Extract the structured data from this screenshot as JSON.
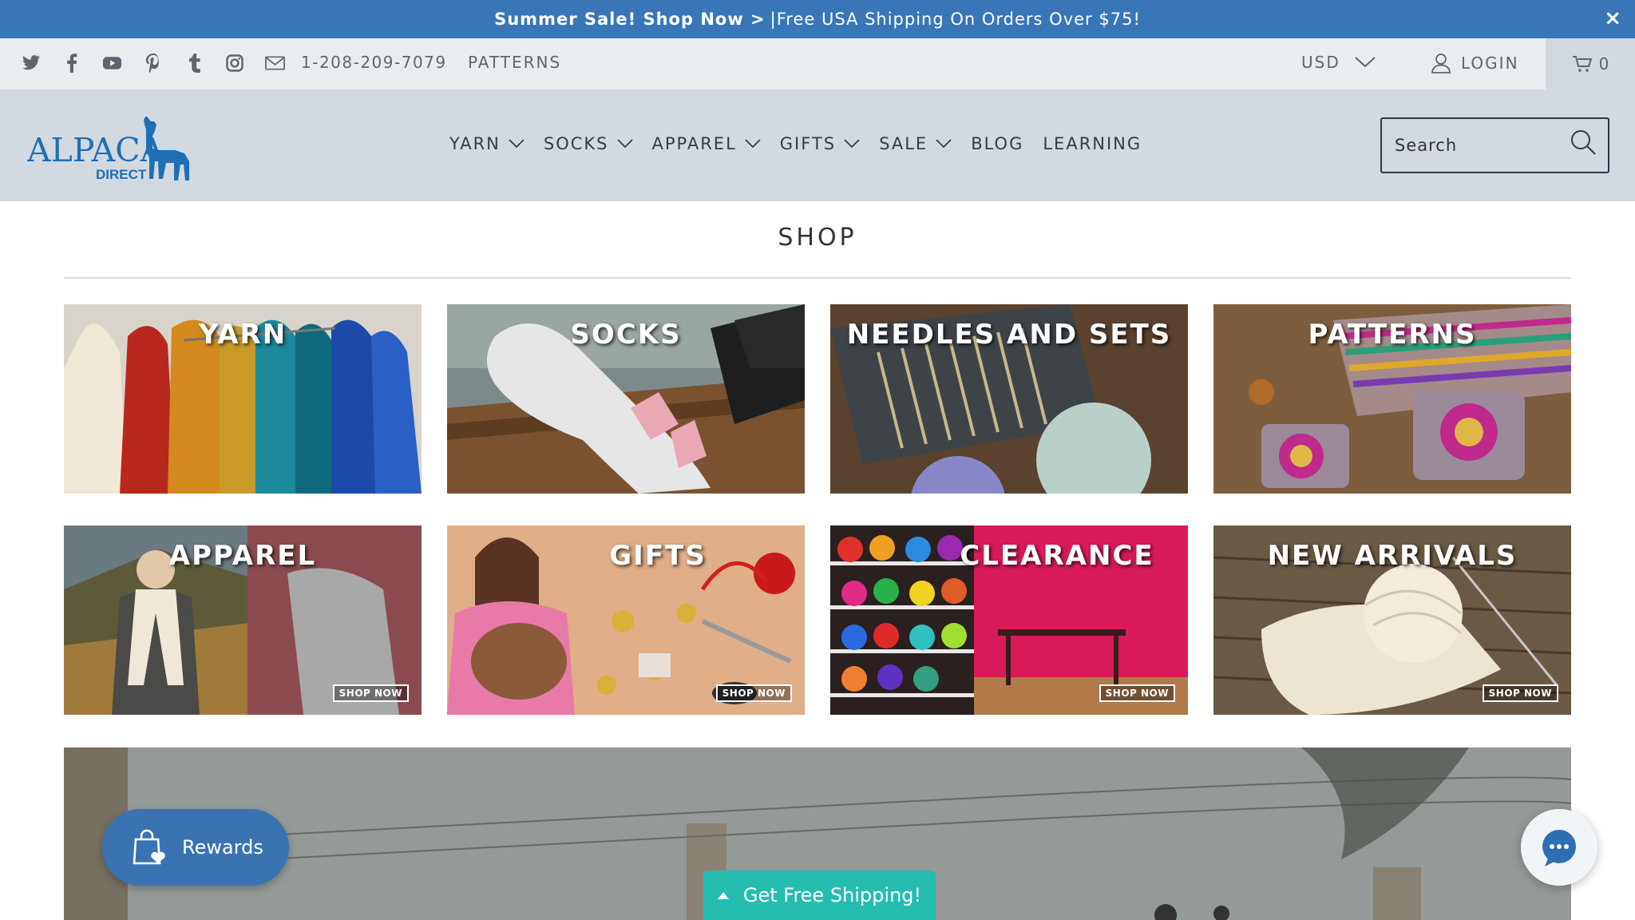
{
  "promo": {
    "bold_text": "Summer Sale! Shop Now >",
    "text": "|Free USA Shipping On Orders Over $75!",
    "close_label": "×"
  },
  "utility": {
    "social_icons": [
      "twitter-icon",
      "facebook-icon",
      "youtube-icon",
      "pinterest-icon",
      "tumblr-icon",
      "instagram-icon",
      "mail-icon"
    ],
    "phone": "1-208-209-7079",
    "patterns_link": "PATTERNS",
    "currency": "USD",
    "login": "LOGIN",
    "cart_count": "0"
  },
  "header": {
    "logo_main": "ALPACA",
    "logo_sub": "DIRECT",
    "nav": [
      {
        "label": "YARN",
        "dropdown": true
      },
      {
        "label": "SOCKS",
        "dropdown": true
      },
      {
        "label": "APPAREL",
        "dropdown": true
      },
      {
        "label": "GIFTS",
        "dropdown": true
      },
      {
        "label": "SALE",
        "dropdown": true
      },
      {
        "label": "BLOG",
        "dropdown": false
      },
      {
        "label": "LEARNING",
        "dropdown": false
      }
    ],
    "search_placeholder": "Search"
  },
  "shop": {
    "title": "SHOP",
    "tiles": [
      {
        "label": "YARN",
        "shop_now": ""
      },
      {
        "label": "SOCKS",
        "shop_now": ""
      },
      {
        "label": "NEEDLES AND SETS",
        "shop_now": ""
      },
      {
        "label": "PATTERNS",
        "shop_now": ""
      },
      {
        "label": "APPAREL",
        "shop_now": "SHOP NOW"
      },
      {
        "label": "GIFTS",
        "shop_now": "SHOP NOW"
      },
      {
        "label": "CLEARANCE",
        "shop_now": "SHOP NOW"
      },
      {
        "label": "NEW ARRIVALS",
        "shop_now": "SHOP NOW"
      }
    ]
  },
  "widgets": {
    "rewards": "Rewards",
    "free_shipping": "Get Free Shipping!"
  },
  "colors": {
    "promo_bar": "#3876b7",
    "utility_bar": "#e9edf0",
    "header": "#d3d9e0",
    "logo_blue": "#1f6fb5",
    "rewards": "#3a73b2",
    "free_shipping": "#26bdb1"
  }
}
